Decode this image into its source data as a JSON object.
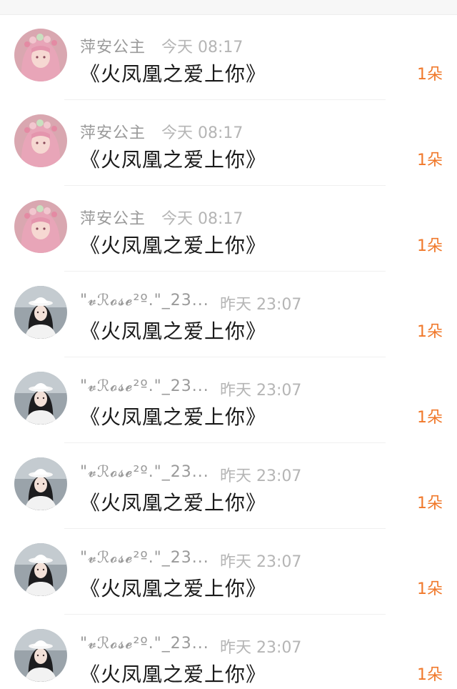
{
  "gift_list": {
    "items": [
      {
        "avatar": "pink-princess",
        "name": "萍安公主",
        "time": "今天 08:17",
        "message": "《火凤凰之爱上你》",
        "count": "1朵"
      },
      {
        "avatar": "pink-princess",
        "name": "萍安公主",
        "time": "今天 08:17",
        "message": "《火凤凰之爱上你》",
        "count": "1朵"
      },
      {
        "avatar": "pink-princess",
        "name": "萍安公主",
        "time": "今天 08:17",
        "message": "《火凤凰之爱上你》",
        "count": "1朵"
      },
      {
        "avatar": "white-hat-girl",
        "name": "\"𝓿ℛ𝓸𝓼𝓮²º.\"_23...",
        "time": "昨天 23:07",
        "message": "《火凤凰之爱上你》",
        "count": "1朵"
      },
      {
        "avatar": "white-hat-girl",
        "name": "\"𝓿ℛ𝓸𝓼𝓮²º.\"_23...",
        "time": "昨天 23:07",
        "message": "《火凤凰之爱上你》",
        "count": "1朵"
      },
      {
        "avatar": "white-hat-girl",
        "name": "\"𝓿ℛ𝓸𝓼𝓮²º.\"_23...",
        "time": "昨天 23:07",
        "message": "《火凤凰之爱上你》",
        "count": "1朵"
      },
      {
        "avatar": "white-hat-girl",
        "name": "\"𝓿ℛ𝓸𝓼𝓮²º.\"_23...",
        "time": "昨天 23:07",
        "message": "《火凤凰之爱上你》",
        "count": "1朵"
      },
      {
        "avatar": "white-hat-girl",
        "name": "\"𝓿ℛ𝓸𝓼𝓮²º.\"_23...",
        "time": "昨天 23:07",
        "message": "《火凤凰之爱上你》",
        "count": "1朵"
      }
    ]
  },
  "colors": {
    "count": "#f0782a",
    "name": "#9a9a9a",
    "time": "#b5b5b5",
    "message": "#1a1a1a"
  }
}
